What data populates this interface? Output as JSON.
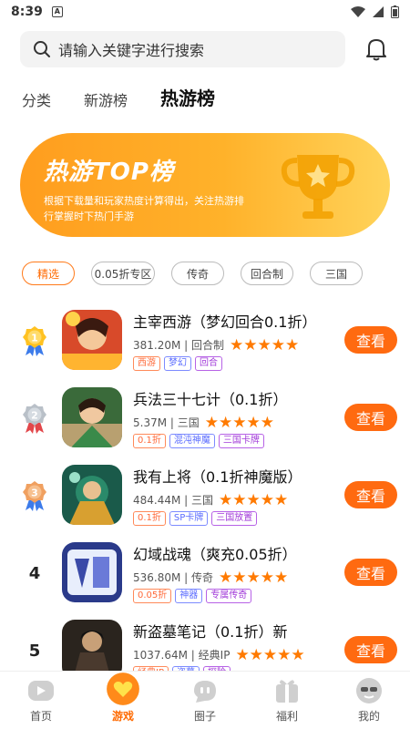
{
  "status": {
    "time": "8:39",
    "notif_glyph": "A"
  },
  "search": {
    "placeholder": "请输入关键字进行搜索"
  },
  "tabs": [
    "分类",
    "新游榜",
    "热游榜"
  ],
  "banner": {
    "title": "热游TOP榜",
    "desc": "根据下载量和玩家热度计算得出，关注热游排行掌握时下热门手游"
  },
  "chips": [
    "精选",
    "0.05折专区",
    "传奇",
    "回合制",
    "三国"
  ],
  "games": [
    {
      "rank": "1",
      "name": "主宰西游（梦幻回合0.1折）",
      "size": "381.20M",
      "genre": "回合制",
      "tags": [
        "西游",
        "梦幻",
        "回合"
      ],
      "view": "查看"
    },
    {
      "rank": "2",
      "name": "兵法三十七计（0.1折）",
      "size": "5.37M",
      "genre": "三国",
      "tags": [
        "0.1折",
        "混沌神魔",
        "三国卡牌"
      ],
      "view": "查看"
    },
    {
      "rank": "3",
      "name": "我有上将（0.1折神魔版）",
      "size": "484.44M",
      "genre": "三国",
      "tags": [
        "0.1折",
        "SP卡牌",
        "三国放置"
      ],
      "view": "查看"
    },
    {
      "rank": "4",
      "name": "幻域战魂（爽充0.05折）",
      "size": "536.80M",
      "genre": "传奇",
      "tags": [
        "0.05折",
        "神器",
        "专属传奇"
      ],
      "view": "查看"
    },
    {
      "rank": "5",
      "name": "新盗墓笔记（0.1折）新",
      "size": "1037.64M",
      "genre": "经典IP",
      "tags": [
        "经典IP",
        "盗墓",
        "探险"
      ],
      "view": "查看"
    }
  ],
  "stars": "★★★★★",
  "nav": [
    "首页",
    "游戏",
    "圈子",
    "福利",
    "我的"
  ],
  "colors": {
    "accent": "#ff6a10",
    "banner_start": "#ff9d1e",
    "banner_end": "#ffd35a"
  }
}
